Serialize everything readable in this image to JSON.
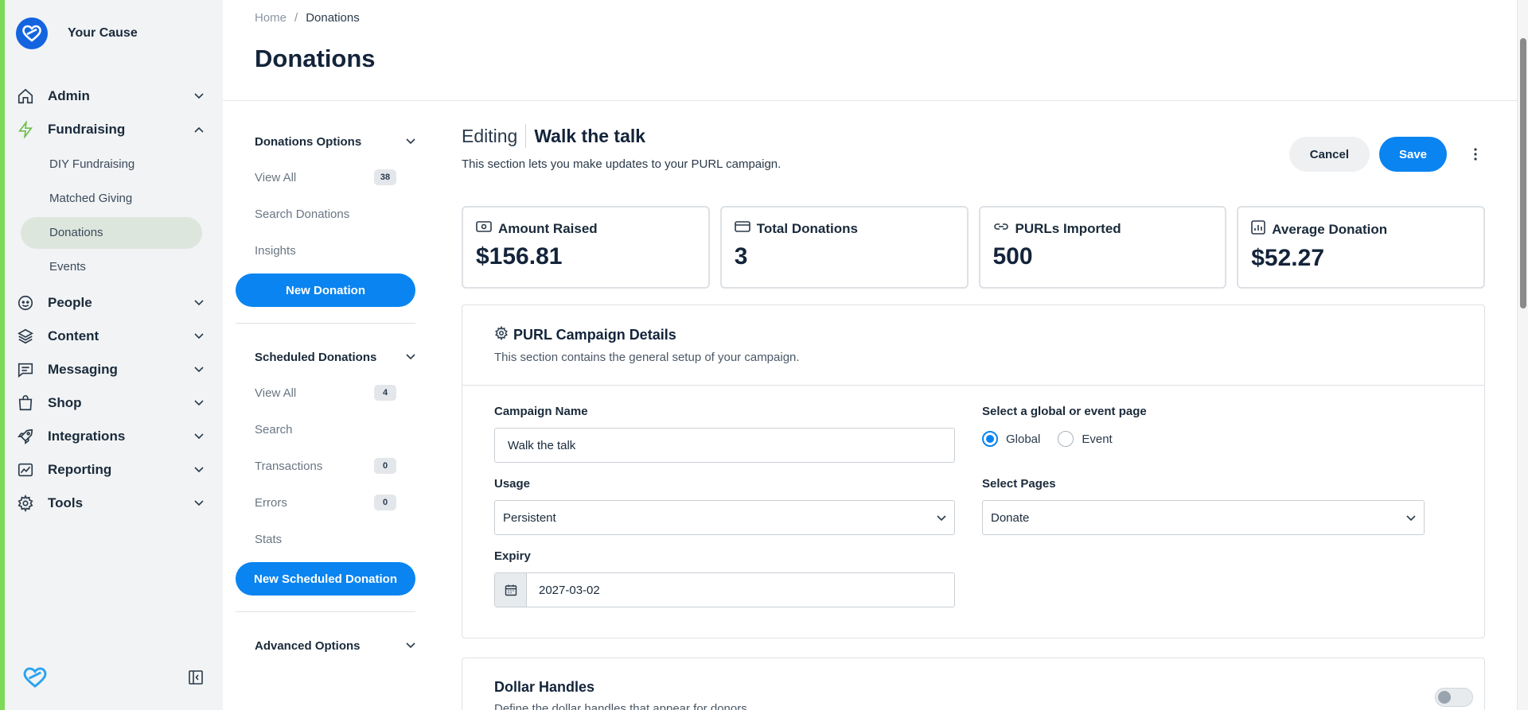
{
  "brand": {
    "name": "Your Cause"
  },
  "sidebar": {
    "items": [
      {
        "label": "Admin",
        "icon": "home-icon"
      },
      {
        "label": "Fundraising",
        "icon": "lightning-icon",
        "expanded": true,
        "children": [
          "DIY Fundraising",
          "Matched Giving",
          "Donations",
          "Events"
        ],
        "active_child": "Donations"
      },
      {
        "label": "People",
        "icon": "face-icon"
      },
      {
        "label": "Content",
        "icon": "layers-icon"
      },
      {
        "label": "Messaging",
        "icon": "chat-icon"
      },
      {
        "label": "Shop",
        "icon": "bag-icon"
      },
      {
        "label": "Integrations",
        "icon": "rocket-icon"
      },
      {
        "label": "Reporting",
        "icon": "chart-icon"
      },
      {
        "label": "Tools",
        "icon": "gear-icon"
      }
    ]
  },
  "header": {
    "breadcrumb": {
      "home": "Home",
      "sep": "/",
      "current": "Donations"
    },
    "title": "Donations"
  },
  "options": {
    "donations": {
      "title": "Donations Options",
      "items": [
        {
          "label": "View All",
          "badge": "38"
        },
        {
          "label": "Search Donations",
          "badge": null
        },
        {
          "label": "Insights",
          "badge": null
        }
      ],
      "button": "New Donation"
    },
    "scheduled": {
      "title": "Scheduled Donations",
      "items": [
        {
          "label": "View All",
          "badge": "4"
        },
        {
          "label": "Search",
          "badge": null
        },
        {
          "label": "Transactions",
          "badge": "0"
        },
        {
          "label": "Errors",
          "badge": "0"
        },
        {
          "label": "Stats",
          "badge": null
        }
      ],
      "button": "New Scheduled Donation"
    },
    "advanced": {
      "title": "Advanced Options"
    }
  },
  "editing": {
    "label": "Editing",
    "name": "Walk the talk",
    "description": "This section lets you make updates to your PURL campaign.",
    "cancel": "Cancel",
    "save": "Save"
  },
  "stats": [
    {
      "label": "Amount Raised",
      "value": "$156.81",
      "icon": "money-icon"
    },
    {
      "label": "Total Donations",
      "value": "3",
      "icon": "card-icon"
    },
    {
      "label": "PURLs Imported",
      "value": "500",
      "icon": "link-icon"
    },
    {
      "label": "Average Donation",
      "value": "$52.27",
      "icon": "bar-chart-icon"
    }
  ],
  "details": {
    "title": "PURL Campaign Details",
    "description": "This section contains the general setup of your campaign.",
    "campaign_name": {
      "label": "Campaign Name",
      "value": "Walk the talk"
    },
    "page_type": {
      "label": "Select a global or event page",
      "options": [
        "Global",
        "Event"
      ],
      "selected": "Global"
    },
    "usage": {
      "label": "Usage",
      "value": "Persistent"
    },
    "pages": {
      "label": "Select Pages",
      "value": "Donate"
    },
    "expiry": {
      "label": "Expiry",
      "value": "2027-03-02"
    }
  },
  "dollar_handles": {
    "title": "Dollar Handles",
    "description": "Define the dollar handles that appear for donors",
    "enabled": false
  },
  "colors": {
    "accent": "#0a84f0",
    "stripe": "#7ed957",
    "brand": "#1464e0"
  }
}
